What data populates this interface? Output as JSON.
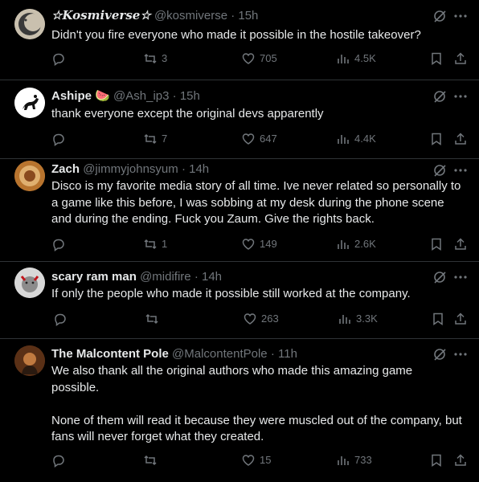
{
  "replies": [
    {
      "name": "☆Kosmiverse☆",
      "handle": "@kosmiverse",
      "time": "15h",
      "text": [
        "Didn't you fire everyone who made it possible in the hostile takeover?"
      ],
      "stats": {
        "reposts": "3",
        "likes": "705",
        "views": "4.5K"
      }
    },
    {
      "name": "Ashipe",
      "emoji": "🍉",
      "handle": "@Ash_ip3",
      "time": "15h",
      "text": [
        "thank everyone except the original devs apparently"
      ],
      "stats": {
        "reposts": "7",
        "likes": "647",
        "views": "4.4K"
      }
    },
    {
      "name": "Zach",
      "handle": "@jimmyjohnsyum",
      "time": "14h",
      "text": [
        "Disco is my favorite media story of all time. Ive never related so personally to a game like this before, I was sobbing at my desk during the phone scene and during the ending. Fuck you Zaum. Give the rights back."
      ],
      "stats": {
        "reposts": "1",
        "likes": "149",
        "views": "2.6K"
      }
    },
    {
      "name": "scary ram man",
      "handle": "@midifire",
      "time": "14h",
      "text": [
        "If only the people who made it possible still worked at the company."
      ],
      "stats": {
        "reposts": "",
        "likes": "263",
        "views": "3.3K"
      }
    },
    {
      "name": "The Malcontent Pole",
      "handle": "@MalcontentPole",
      "time": "11h",
      "text": [
        "We also thank all the original authors who made this amazing game possible.",
        "None of them will read it because they were muscled out of the company, but fans will never forget what they created."
      ],
      "stats": {
        "reposts": "",
        "likes": "15",
        "views": "733"
      }
    }
  ],
  "colors": {
    "background": "#000000",
    "text": "#e7e9ea",
    "muted": "#71767b",
    "divider": "#2f3336"
  },
  "icons": [
    "reply-icon",
    "repost-icon",
    "like-icon",
    "views-icon",
    "bookmark-icon",
    "share-icon",
    "grok-icon",
    "more-icon"
  ]
}
